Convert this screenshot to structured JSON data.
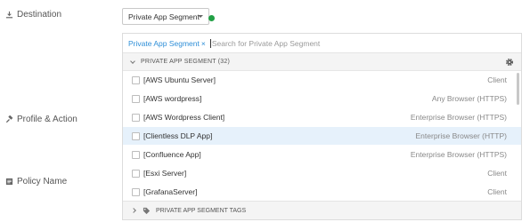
{
  "labels": {
    "destination": "Destination",
    "profile_action": "Profile & Action",
    "policy_name": "Policy Name"
  },
  "destination_select": {
    "value": "Private App Segment",
    "status_color": "#22a045"
  },
  "search": {
    "chip": "Private App Segment",
    "chip_remove": "×",
    "placeholder": "Search for Private App Segment"
  },
  "group": {
    "title": "PRIVATE APP SEGMENT (32)"
  },
  "items": [
    {
      "name": "[AWS Ubuntu Server]",
      "type": "Client",
      "selected": false
    },
    {
      "name": "[AWS wordpress]",
      "type": "Any Browser (HTTPS)",
      "selected": false
    },
    {
      "name": "[AWS Wordpress Client]",
      "type": "Enterprise Browser (HTTPS)",
      "selected": false
    },
    {
      "name": "[Clientless DLP App]",
      "type": "Enterprise Browser (HTTP)",
      "selected": true
    },
    {
      "name": "[Confluence App]",
      "type": "Enterprise Browser (HTTPS)",
      "selected": false
    },
    {
      "name": "[Esxi Server]",
      "type": "Client",
      "selected": false
    },
    {
      "name": "[GrafanaServer]",
      "type": "Client",
      "selected": false
    }
  ],
  "tags_group": {
    "title": "PRIVATE APP SEGMENT TAGS"
  },
  "colors": {
    "accent": "#2f8fd8",
    "selected_row": "#e6f1fb"
  }
}
